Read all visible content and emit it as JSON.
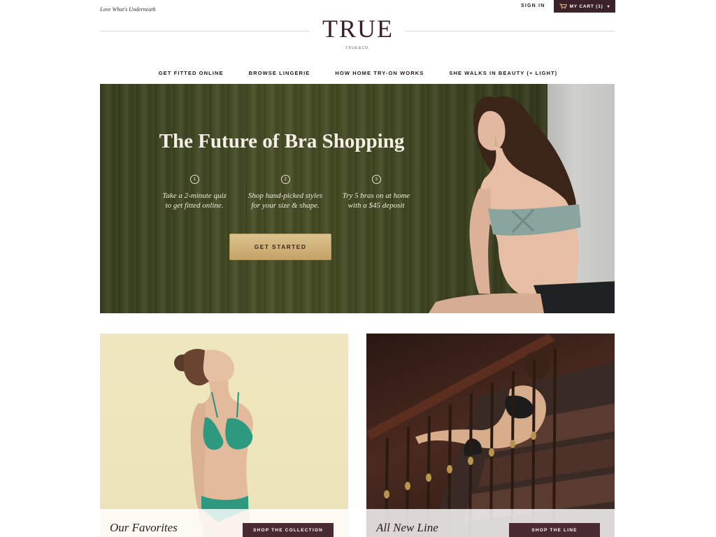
{
  "header": {
    "tagline": "Love What's Underneath",
    "sign_in": "SIGN IN",
    "cart_label": "MY CART (1)",
    "logo": "TRUE",
    "logo_sub": "TRUE&CO."
  },
  "nav": [
    "GET FITTED ONLINE",
    "BROWSE LINGERIE",
    "HOW HOME TRY-ON WORKS",
    "SHE WALKS IN BEAUTY (+ LIGHT)"
  ],
  "hero": {
    "title": "The Future of Bra Shopping",
    "steps": [
      {
        "num": "1",
        "line1": "Take a 2-minute quiz",
        "line2": "to get fitted online."
      },
      {
        "num": "2",
        "line1": "Shop hand-picked styles",
        "line2": "for your size & shape."
      },
      {
        "num": "3",
        "line1": "Try 5 bras on at home",
        "line2": "with a $45 deposit"
      }
    ],
    "cta": "GET STARTED"
  },
  "tiles": [
    {
      "title": "Our Favorites",
      "button": "SHOP THE COLLECTION"
    },
    {
      "title": "All New Line",
      "button": "SHOP THE LINE"
    }
  ],
  "colors": {
    "brand": "#3d1a2c",
    "cart_bg": "#3b2129",
    "cta_gold": "#d2b57b",
    "tile_button": "#4a2a33"
  },
  "icons": {
    "cart": "shopping-cart-icon",
    "caret": "chevron-down-icon"
  }
}
